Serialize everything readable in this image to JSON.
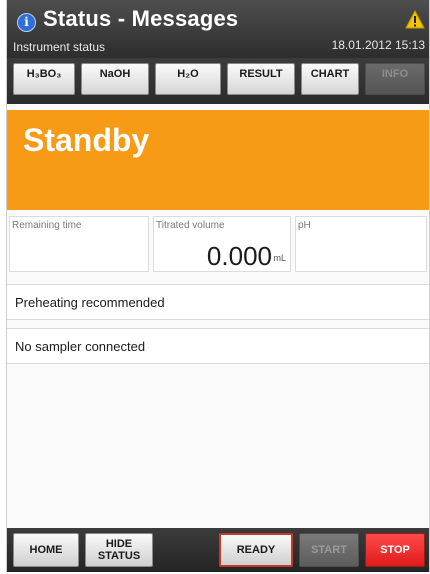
{
  "header": {
    "title": "Status - Messages",
    "subtitle": "Instrument status",
    "datetime": "18.01.2012 15:13",
    "info_icon": "info-icon",
    "warning_icon": "warning-icon"
  },
  "tabs": [
    {
      "label": "H₃BO₃",
      "enabled": true
    },
    {
      "label": "NaOH",
      "enabled": true
    },
    {
      "label": "H₂O",
      "enabled": true
    },
    {
      "label": "RESULT",
      "enabled": true
    },
    {
      "label": "CHART",
      "enabled": true
    },
    {
      "label": "INFO",
      "enabled": false
    }
  ],
  "status": {
    "label": "Standby",
    "color": "#f79a16"
  },
  "values": {
    "remaining_time_label": "Remaining time",
    "remaining_time_value": "",
    "titrated_volume_label": "Titrated volume",
    "titrated_volume_value": "0.000",
    "titrated_volume_unit": "mL",
    "ph_label": "pH",
    "ph_value": ""
  },
  "messages": [
    "Preheating recommended",
    "No sampler connected"
  ],
  "footer": {
    "home": "HOME",
    "hide_status": "HIDE STATUS",
    "ready": "READY",
    "start": "START",
    "stop": "STOP"
  },
  "colors": {
    "accent_orange": "#f79a16",
    "stop_red": "#e01b1b",
    "ready_border": "#c33a2a",
    "header_dark": "#3a3a3a"
  }
}
